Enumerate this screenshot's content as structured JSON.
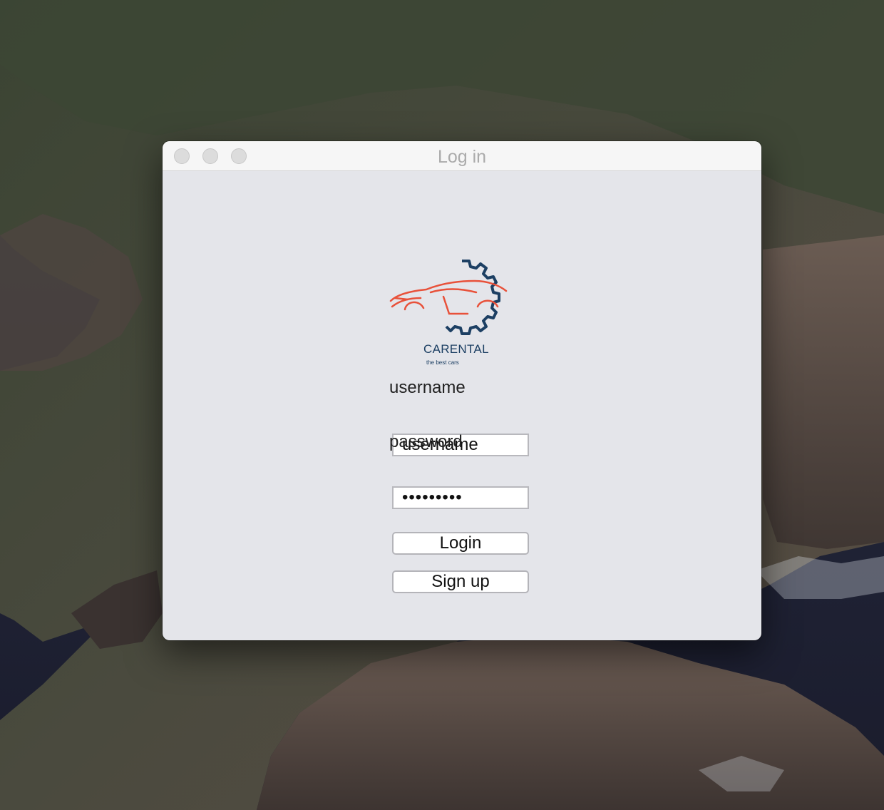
{
  "window": {
    "title": "Log in"
  },
  "logo": {
    "name": "CARENTAL",
    "tagline": "the best cars",
    "colors": {
      "car": "#e8513a",
      "gear": "#1c3f63"
    }
  },
  "form": {
    "username_label": "username",
    "username_value": "username",
    "password_label": "password",
    "password_value": "•••••••••",
    "login_label": "Login",
    "signup_label": "Sign up"
  }
}
